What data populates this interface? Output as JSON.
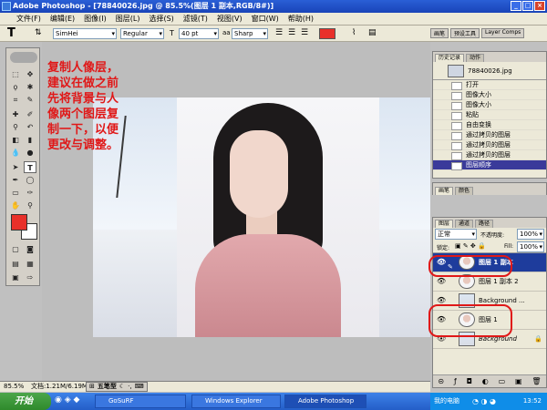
{
  "window": {
    "title": "Adobe Photoshop - [78840026.jpg @ 85.5%(图层 1 副本,RGB/8#)]",
    "controls": [
      "_",
      "□",
      "×"
    ]
  },
  "menu": [
    "文件(F)",
    "编辑(E)",
    "图像(I)",
    "图层(L)",
    "选择(S)",
    "滤镜(T)",
    "视图(V)",
    "窗口(W)",
    "帮助(H)"
  ],
  "options": {
    "tool_glyph": "T",
    "font_family": "SimHei",
    "font_style": "Regular",
    "font_size": "40 pt",
    "antialias": "Sharp",
    "text_color": "#e8302a",
    "palette_tabs": [
      "画笔",
      "预设工具",
      "Layer Comps"
    ]
  },
  "annotation": "复制人像层，\n建议在做之前\n先将背景与人\n像两个图层复\n制一下，以便\n更改与调整。",
  "history": {
    "tabs": [
      "历史记录",
      "动作"
    ],
    "snapshot": "78840026.jpg",
    "items": [
      "打开",
      "图像大小",
      "图像大小",
      "粘贴",
      "自由变换",
      "通过拷贝的图层",
      "通过拷贝的图层",
      "通过拷贝的图层",
      "图层顺序"
    ]
  },
  "mid_tabs": [
    "画笔",
    "颜色"
  ],
  "layers": {
    "tabs": [
      "图层",
      "通道",
      "路径"
    ],
    "blend": "正常",
    "opacity_label": "不透明度:",
    "opacity": "100%",
    "lock_label": "锁定:",
    "fill_label": "Fill:",
    "fill": "100%",
    "rows": [
      {
        "name": "图层 1 副本",
        "selected": true
      },
      {
        "name": "图层 1 副本 2",
        "selected": false
      },
      {
        "name": "Background ...",
        "selected": false
      },
      {
        "name": "图层 1",
        "selected": false
      },
      {
        "name": "Background",
        "selected": false
      }
    ]
  },
  "status": {
    "zoom": "85.5%",
    "doc": "文档:1.21M/6.19M"
  },
  "ime": "五笔型",
  "taskbar": {
    "start": "开始",
    "buttons": [
      "GoSuRF",
      "Windows Explorer",
      "Adobe Photoshop"
    ],
    "tray_label": "我的电脑",
    "clock": "13:52"
  }
}
